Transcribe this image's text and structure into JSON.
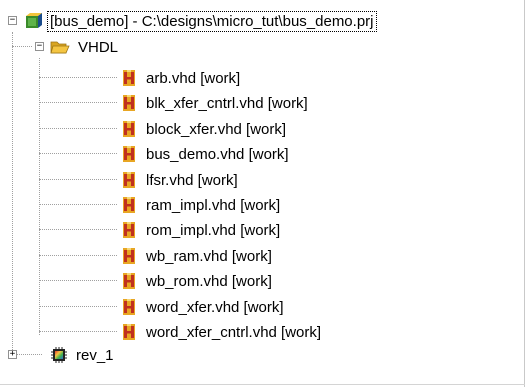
{
  "tree": {
    "project": {
      "label": "[bus_demo]  -  C:\\designs\\micro_tut\\bus_demo.prj",
      "expander": "−"
    },
    "vhdl_folder": {
      "label": "VHDL",
      "expander": "−"
    },
    "files": [
      {
        "label": "arb.vhd [work]"
      },
      {
        "label": "blk_xfer_cntrl.vhd [work]"
      },
      {
        "label": "block_xfer.vhd [work]"
      },
      {
        "label": "bus_demo.vhd [work]"
      },
      {
        "label": "lfsr.vhd [work]"
      },
      {
        "label": "ram_impl.vhd [work]"
      },
      {
        "label": "rom_impl.vhd [work]"
      },
      {
        "label": "wb_ram.vhd [work]"
      },
      {
        "label": "wb_rom.vhd [work]"
      },
      {
        "label": "word_xfer.vhd [work]"
      },
      {
        "label": "word_xfer_cntrl.vhd [work]"
      }
    ],
    "rev": {
      "label": "rev_1",
      "expander": "+"
    }
  },
  "icons": {
    "project": "project-cube-icon",
    "folder": "open-folder-icon",
    "file": "vhdl-file-icon",
    "rev": "implementation-chip-icon"
  },
  "colors": {
    "background": "#ffffff",
    "tree_lines": "#a0a0a0",
    "file_icon_red": "#c0301f",
    "file_icon_gold": "#e8a623",
    "folder_yellow": "#f4c542"
  }
}
